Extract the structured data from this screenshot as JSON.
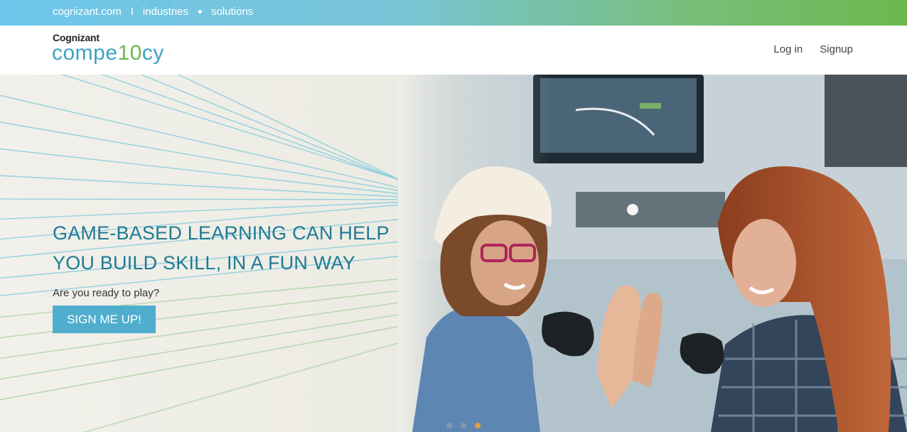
{
  "topbar": {
    "links": [
      "cognizant.com",
      "industries",
      "solutions"
    ],
    "separator": "I"
  },
  "header": {
    "brand_top": "Cognizant",
    "brand_prefix": "compe",
    "brand_accent": "10",
    "brand_suffix": "cy",
    "login": "Log in",
    "signup": "Signup"
  },
  "hero": {
    "headline_line1": "GAME-BASED LEARNING CAN HELP",
    "headline_line2": "YOU BUILD SKILL, IN A FUN WAY",
    "subtext": "Are you ready to play?",
    "cta": "SIGN ME UP!",
    "image": "two-women-high-five-with-game-controllers",
    "carousel_total": 3,
    "carousel_active": 3
  },
  "colors": {
    "brand_blue": "#3ea3c4",
    "brand_green": "#6cb84e",
    "headline": "#1f7a95",
    "cta_bg": "#4faecd",
    "carousel_active": "#e3a23b"
  }
}
